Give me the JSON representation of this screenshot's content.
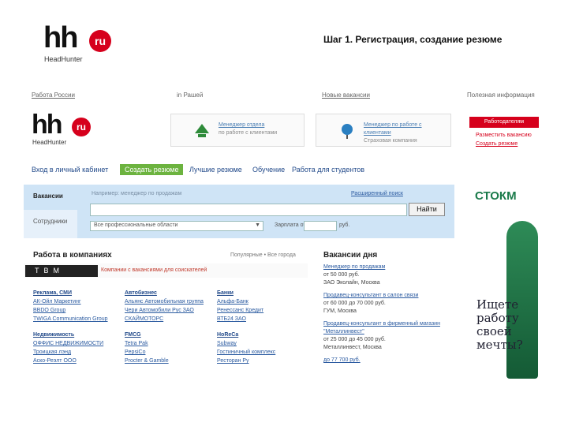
{
  "slide": {
    "logo_hh": "hh",
    "logo_ru": "ru",
    "logo_sub": "HeadHunter",
    "title": "Шаг 1. Регистрация, создание резюме"
  },
  "site": {
    "topnav": [
      "Работа России",
      "in Рашей",
      "Новые вакансии",
      "Полезная информация"
    ],
    "logo_hh": "hh",
    "logo_ru": "ru",
    "logo_sub": "HeadHunter",
    "banners": [
      {
        "line1": "Менеджер отдела",
        "line2": "по работе с клиентами"
      },
      {
        "line1": "Менеджер по работе с клиентами",
        "line2": "Страховая компания"
      }
    ],
    "register_button": "Работодателям",
    "register_link1": "Разместить вакансию",
    "register_link2": "Создать резюме",
    "mainnav": {
      "login": "Вход в личный кабинет",
      "create_resume": "Создать резюме",
      "best_resumes": "Лучшие резюме",
      "training": "Обучение",
      "students": "Работа для студентов"
    },
    "search": {
      "tab_vacancies": "Вакансии",
      "tab_employees": "Сотрудники",
      "hint": "Например: менеджер по продажам",
      "extended": "Расширенный поиск",
      "button": "Найти",
      "select_value": "Все профессиональные области",
      "salary_label": "Зарплата от",
      "currency": "руб."
    },
    "companies": {
      "title": "Работа в компаниях",
      "links": "Популярные  •  Все города",
      "banner_logo": "ТВМ",
      "banner_text": "Компании с вакансиями для соискателей",
      "columns": [
        {
          "head": "Реклама, СМИ",
          "items": [
            "АК-Ойл Маркетинг",
            "BBDO Group",
            "TWIGA Communication Group"
          ],
          "head2": "Недвижимость",
          "items2": [
            "ОФФИС НЕДВИЖИМОСТИ",
            "Троицкая лэнд",
            "Аско-Реэлт ООО"
          ]
        },
        {
          "head": "Автобизнес",
          "items": [
            "Альянс Автомобильная группа",
            "Чери Автомобили Рус ЗАО",
            "СКАЙМОТОРС"
          ],
          "head2": "FMCG",
          "items2": [
            "Tetra Pak",
            "PepsiCo",
            "Procter & Gamble"
          ]
        },
        {
          "head": "Банки",
          "items": [
            "Альфа-Банк",
            "Ренессанс Кредит",
            "ВТБ24 ЗАО"
          ],
          "head2": "HoReCa",
          "items2": [
            "Subway",
            "Гостиничный комплекс",
            "Ресторан Ру"
          ]
        }
      ]
    },
    "vacancies": {
      "title": "Вакансии дня",
      "items": [
        {
          "t": "Менеджер по продажам",
          "s": "от 50 000 руб.",
          "c": "ЗАО Эколайн, Москва"
        },
        {
          "t": "Продавец-консультант в салон связи",
          "s": "от 60 000 до 70 000 руб.",
          "c": "ГУМ, Москва"
        },
        {
          "t": "Продавец-консультант в фирменный магазин \"Металлинвест\"",
          "s": "от 25 000 до 45 000 руб.",
          "c": "Металлинвест, Москва"
        },
        {
          "t": "",
          "s": "до 77 700 руб.",
          "c": ""
        }
      ]
    },
    "ad": {
      "logo": "СТОКМ",
      "text1": "Ищете",
      "text2": "работу",
      "text3": "своей",
      "text4": "мечты?"
    }
  }
}
